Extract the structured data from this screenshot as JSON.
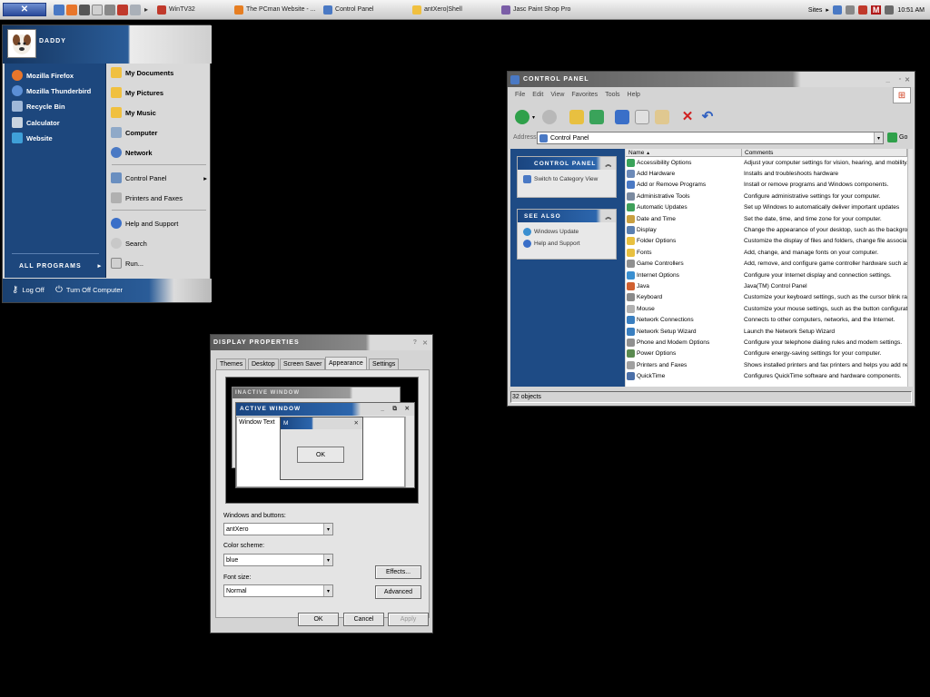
{
  "taskbar": {
    "start_label": "✕",
    "buttons": [
      {
        "label": "WinTV32",
        "color": "#c0392b"
      },
      {
        "label": "The PCman Website - ...",
        "color": "#e67e22"
      },
      {
        "label": "Control Panel",
        "color": "#4a79c4"
      },
      {
        "label": "antXero|Shell",
        "color": "#f0c040"
      },
      {
        "label": "Jasc Paint Shop Pro",
        "color": "#7b5ea7"
      }
    ],
    "sites_label": "Sites",
    "clock": "10:51 AM"
  },
  "start_menu": {
    "user_name": "Daddy",
    "left_items": [
      {
        "label": "Mozilla Firefox",
        "icon": "firefox-icon",
        "color": "#e8762b"
      },
      {
        "label": "Mozilla Thunderbird",
        "icon": "thunderbird-icon",
        "color": "#5b8fd6"
      },
      {
        "label": "Recycle Bin",
        "icon": "recycle-bin-icon",
        "color": "#9fb8d8"
      },
      {
        "label": "Calculator",
        "icon": "calculator-icon",
        "color": "#c9d4e0"
      },
      {
        "label": "Website",
        "icon": "website-icon",
        "color": "#3fa0d8"
      }
    ],
    "right_items": [
      {
        "label": "My Documents",
        "icon": "folder-icon",
        "color": "#f0c040"
      },
      {
        "label": "My Pictures",
        "icon": "folder-icon",
        "color": "#f0c040"
      },
      {
        "label": "My Music",
        "icon": "folder-icon",
        "color": "#f0c040"
      },
      {
        "label": "Computer",
        "icon": "computer-icon",
        "color": "#8fa9c8"
      },
      {
        "label": "Network",
        "icon": "network-icon",
        "color": "#4a79c4"
      }
    ],
    "right_items_2": [
      {
        "label": "Control Panel",
        "icon": "control-panel-icon",
        "color": "#6a8fc0",
        "arrow": "▸"
      },
      {
        "label": "Printers and Faxes",
        "icon": "printer-icon",
        "color": "#b0b0b0",
        "arrow": ""
      }
    ],
    "right_items_3": [
      {
        "label": "Help and Support",
        "icon": "help-icon",
        "color": "#3a6fc8"
      },
      {
        "label": "Search",
        "icon": "search-icon",
        "color": "#c8c8c8"
      },
      {
        "label": "Run...",
        "icon": "run-icon",
        "color": "#d0d0d0"
      }
    ],
    "all_programs": "All Programs",
    "log_off": "Log Off",
    "turn_off": "Turn Off Computer"
  },
  "control_panel": {
    "title": "Control Panel",
    "menu": [
      "File",
      "Edit",
      "View",
      "Favorites",
      "Tools",
      "Help"
    ],
    "address_label": "Address",
    "address_value": "Control Panel",
    "go_label": "Go",
    "task_panel_title": "Control Panel",
    "switch_view": "Switch to Category View",
    "see_also_title": "See Also",
    "see_also": [
      "Windows Update",
      "Help and Support"
    ],
    "columns": [
      "Name",
      "Comments"
    ],
    "items": [
      {
        "name": "Accessibility Options",
        "comment": "Adjust your computer settings for vision, hearing, and mobility.",
        "color": "#3aa35a"
      },
      {
        "name": "Add Hardware",
        "comment": "Installs and troubleshoots hardware",
        "color": "#6c8ab8"
      },
      {
        "name": "Add or Remove Programs",
        "comment": "Install or remove programs and Windows components.",
        "color": "#4a79c4"
      },
      {
        "name": "Administrative Tools",
        "comment": "Configure administrative settings for your computer.",
        "color": "#7a8aa0"
      },
      {
        "name": "Automatic Updates",
        "comment": "Set up Windows to automatically deliver important updates",
        "color": "#3fa05a"
      },
      {
        "name": "Date and Time",
        "comment": "Set the date, time, and time zone for your computer.",
        "color": "#c9a040"
      },
      {
        "name": "Display",
        "comment": "Change the appearance of your desktop, such as the background",
        "color": "#5a7fb0"
      },
      {
        "name": "Folder Options",
        "comment": "Customize the display of files and folders, change file associations",
        "color": "#e8c040"
      },
      {
        "name": "Fonts",
        "comment": "Add, change, and manage fonts on your computer.",
        "color": "#e8c040"
      },
      {
        "name": "Game Controllers",
        "comment": "Add, remove, and configure game controller hardware such as joysticks",
        "color": "#909090"
      },
      {
        "name": "Internet Options",
        "comment": "Configure your Internet display and connection settings.",
        "color": "#3a8fd0"
      },
      {
        "name": "Java",
        "comment": "Java(TM) Control Panel",
        "color": "#d06030"
      },
      {
        "name": "Keyboard",
        "comment": "Customize your keyboard settings, such as the cursor blink rate",
        "color": "#8a8a8a"
      },
      {
        "name": "Mouse",
        "comment": "Customize your mouse settings, such as the button configuration",
        "color": "#b0b0b0"
      },
      {
        "name": "Network Connections",
        "comment": "Connects to other computers, networks, and the Internet.",
        "color": "#3a7fc0"
      },
      {
        "name": "Network Setup Wizard",
        "comment": "Launch the Network Setup Wizard",
        "color": "#3a7fc0"
      },
      {
        "name": "Phone and Modem Options",
        "comment": "Configure your telephone dialing rules and modem settings.",
        "color": "#909090"
      },
      {
        "name": "Power Options",
        "comment": "Configure energy-saving settings for your computer.",
        "color": "#5a8a50"
      },
      {
        "name": "Printers and Faxes",
        "comment": "Shows installed printers and fax printers and helps you add new ones.",
        "color": "#a0a0a0"
      },
      {
        "name": "QuickTime",
        "comment": "Configures QuickTime software and hardware components.",
        "color": "#4a6fa8"
      }
    ],
    "status": "32 objects"
  },
  "display_properties": {
    "title": "Display Properties",
    "tabs": [
      "Themes",
      "Desktop",
      "Screen Saver",
      "Appearance",
      "Settings"
    ],
    "preview": {
      "inactive_title": "Inactive Window",
      "active_title": "Active Window",
      "window_text": "Window Text",
      "message_title": "M",
      "ok": "OK"
    },
    "windows_buttons_label": "Windows and buttons:",
    "windows_buttons_value": "antXero",
    "color_scheme_label": "Color scheme:",
    "color_scheme_value": "blue",
    "font_size_label": "Font size:",
    "font_size_value": "Normal",
    "effects": "Effects...",
    "advanced": "Advanced",
    "ok": "OK",
    "cancel": "Cancel",
    "apply": "Apply"
  }
}
